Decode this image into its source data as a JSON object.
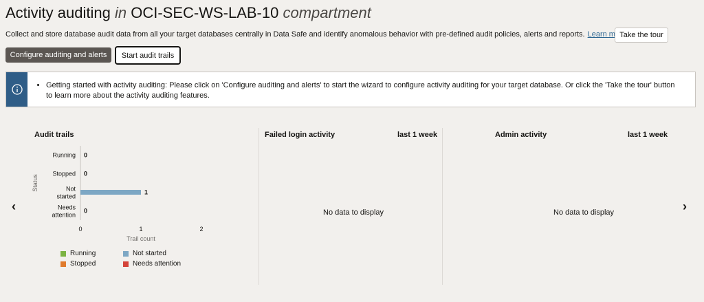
{
  "header": {
    "title_main": "Activity auditing ",
    "title_in": "in",
    "title_compartment": " OCI-SEC-WS-LAB-10 ",
    "title_suffix": "compartment",
    "description": "Collect and store database audit data from all your target databases centrally in Data Safe and identify anomalous behavior with pre-defined audit policies, alerts and reports.",
    "learn_more": "Learn more",
    "tour_button": "Take the tour"
  },
  "actions": {
    "configure": "Configure auditing and alerts",
    "start_trails": "Start audit trails"
  },
  "banner": {
    "text": "Getting started with activity auditing: Please click on 'Configure auditing and alerts' to start the wizard to configure activity auditing for your target database. Or click the 'Take the tour' button to learn more about the activity auditing features."
  },
  "panels": {
    "audit_trails": {
      "title": "Audit trails"
    },
    "failed_login": {
      "title": "Failed login activity",
      "period": "last 1 week",
      "empty": "No data to display"
    },
    "admin": {
      "title": "Admin activity",
      "period": "last 1 week",
      "empty": "No data to display"
    }
  },
  "chart_data": {
    "type": "bar",
    "orientation": "horizontal",
    "title": "Audit trails",
    "categories": [
      "Running",
      "Stopped",
      "Not started",
      "Needs attention"
    ],
    "values": [
      0,
      0,
      1,
      0
    ],
    "xlabel": "Trail count",
    "ylabel": "Status",
    "xlim": [
      0,
      2
    ],
    "xticks": [
      "0",
      "1",
      "2"
    ],
    "colors": [
      "#7cb342",
      "#e07b2c",
      "#7da7c4",
      "#d4443a"
    ],
    "legend": [
      "Running",
      "Not started",
      "Stopped",
      "Needs attention"
    ],
    "legend_colors": [
      "#7cb342",
      "#7da7c4",
      "#e07b2c",
      "#d4443a"
    ]
  }
}
